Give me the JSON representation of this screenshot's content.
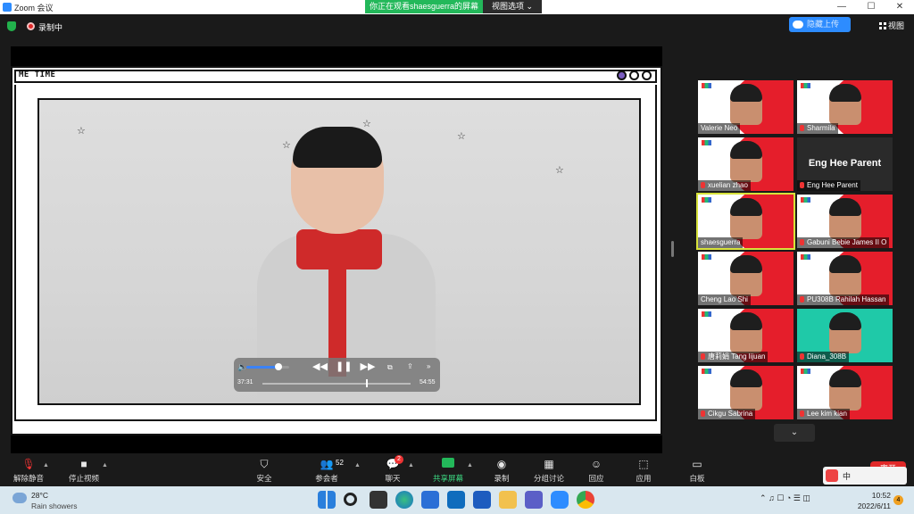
{
  "window": {
    "title": "Zoom 会议",
    "viewing_banner": "你正在观看shaesguerra的屏幕",
    "view_options": "视图选项 ⌄",
    "controls": [
      "—",
      "☐",
      "✕"
    ]
  },
  "topbar": {
    "recording": "录制中",
    "cloud_upload": "隐藏上传",
    "view": "视图"
  },
  "shared_screen": {
    "frame_title": "ME TIME",
    "video": {
      "current_time": "37:31",
      "duration": "54:55",
      "volume_fraction": 0.75,
      "progress_fraction": 0.7,
      "buttons": [
        "◀◀",
        "❚❚",
        "▶▶"
      ]
    }
  },
  "gallery": {
    "participants": [
      {
        "name": "Valerie Neo",
        "muted": false,
        "style": "photo"
      },
      {
        "name": "Sharmila",
        "muted": true,
        "style": "photo"
      },
      {
        "name": "xuelian zhao",
        "muted": true,
        "style": "photo"
      },
      {
        "name": "Eng Hee Parent",
        "muted": true,
        "style": "dark",
        "big_name": "Eng Hee Parent"
      },
      {
        "name": "shaesguerra",
        "muted": false,
        "style": "active"
      },
      {
        "name": "Gabuni Bebie James II O",
        "muted": true,
        "style": "photo"
      },
      {
        "name": "Cheng Lao Shi",
        "muted": false,
        "style": "photo"
      },
      {
        "name": "PU308B Rahilah Hassan",
        "muted": true,
        "style": "photo"
      },
      {
        "name": "唐莉娟  Tang lijuan",
        "muted": true,
        "style": "photo"
      },
      {
        "name": "Diana_308B",
        "muted": true,
        "style": "teal"
      },
      {
        "name": "Cikgu Sabrina",
        "muted": true,
        "style": "photo"
      },
      {
        "name": "Lee kim kian",
        "muted": true,
        "style": "photo"
      }
    ]
  },
  "toolbar": {
    "unmute": "解除静音",
    "start_video": "停止视频",
    "security": "安全",
    "participants": "参会者",
    "participants_count": "52",
    "chat": "聊天",
    "chat_badge": "2",
    "share_screen": "共享屏幕",
    "record": "录制",
    "breakout": "分组讨论",
    "reactions": "回应",
    "apps": "应用",
    "whiteboard": "白板",
    "end": "离开"
  },
  "taskbar": {
    "weather_temp": "28°C",
    "weather_desc": "Rain showers",
    "time": "10:52",
    "date": "2022/6/11",
    "notifications": "4",
    "tray_lang": "中"
  }
}
